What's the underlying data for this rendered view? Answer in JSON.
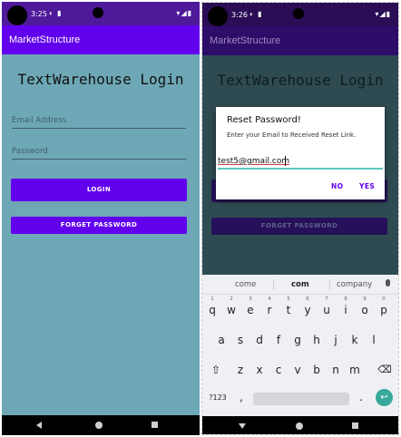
{
  "status": {
    "time_left": "3:25",
    "time_right": "3:26",
    "icons": "◐ ▮",
    "right_icons": "▾◢▮"
  },
  "app": {
    "title": "MarketStructure"
  },
  "login": {
    "heading": "TextWarehouse Login",
    "email_placeholder": "Email Address",
    "password_placeholder": "Password",
    "login_button": "LOGIN",
    "forgot_button": "FORGET PASSWORD"
  },
  "dialog": {
    "title": "Reset Password!",
    "message": "Enter your Email to Received Reset Link.",
    "input_value": "test5@gmail.com",
    "no_button": "NO",
    "yes_button": "YES"
  },
  "keyboard": {
    "suggestions": [
      "come",
      "com",
      "company"
    ],
    "row1": [
      "q",
      "w",
      "e",
      "r",
      "t",
      "y",
      "u",
      "i",
      "o",
      "p"
    ],
    "row1_digits": [
      "1",
      "2",
      "3",
      "4",
      "5",
      "6",
      "7",
      "8",
      "9",
      "0"
    ],
    "row2": [
      "a",
      "s",
      "d",
      "f",
      "g",
      "h",
      "j",
      "k",
      "l"
    ],
    "row3": [
      "z",
      "x",
      "c",
      "v",
      "b",
      "n",
      "m"
    ],
    "shift": "⇧",
    "backspace": "⌫",
    "symbols": "?123",
    "comma": ",",
    "period": ".",
    "enter": "↩"
  },
  "colors": {
    "primary": "#6200ee",
    "background": "#6ea8b7",
    "accent": "#5ec8c0"
  }
}
